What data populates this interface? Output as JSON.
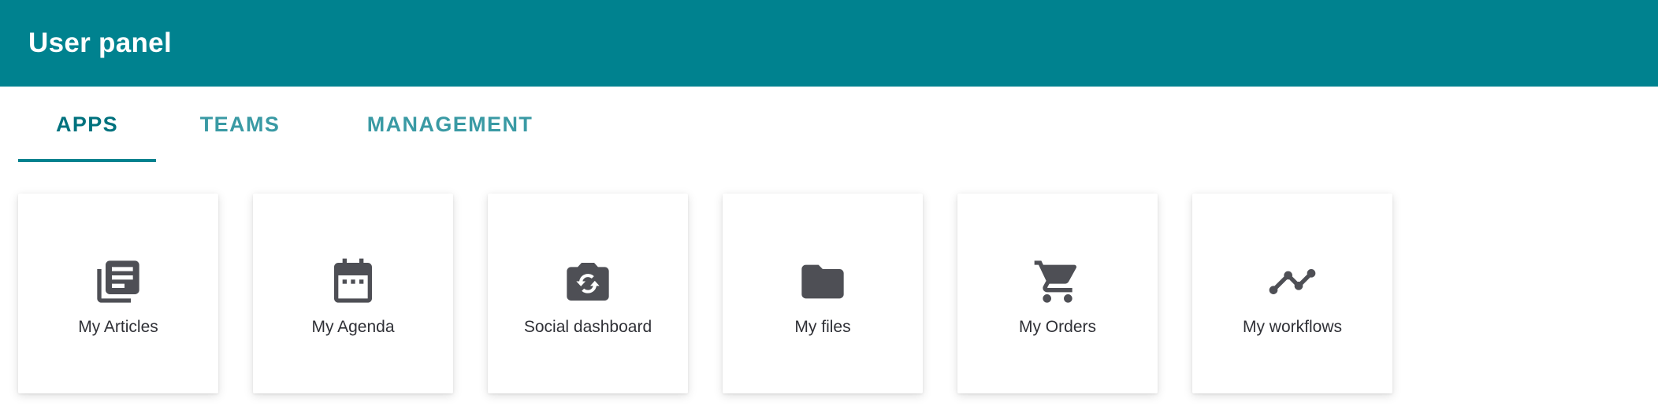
{
  "header": {
    "title": "User panel",
    "background_color": "#00828f"
  },
  "tabs": [
    {
      "label": "APPS",
      "active": true
    },
    {
      "label": "TEAMS",
      "active": false
    },
    {
      "label": "MANAGEMENT",
      "active": false
    }
  ],
  "apps": [
    {
      "label": "My Articles",
      "icon": "articles-icon"
    },
    {
      "label": "My Agenda",
      "icon": "calendar-icon"
    },
    {
      "label": "Social dashboard",
      "icon": "camera-icon"
    },
    {
      "label": "My files",
      "icon": "folder-icon"
    },
    {
      "label": "My Orders",
      "icon": "cart-icon"
    },
    {
      "label": "My workflows",
      "icon": "workflow-icon"
    }
  ],
  "colors": {
    "accent": "#00828f",
    "icon": "#4e4f55"
  }
}
